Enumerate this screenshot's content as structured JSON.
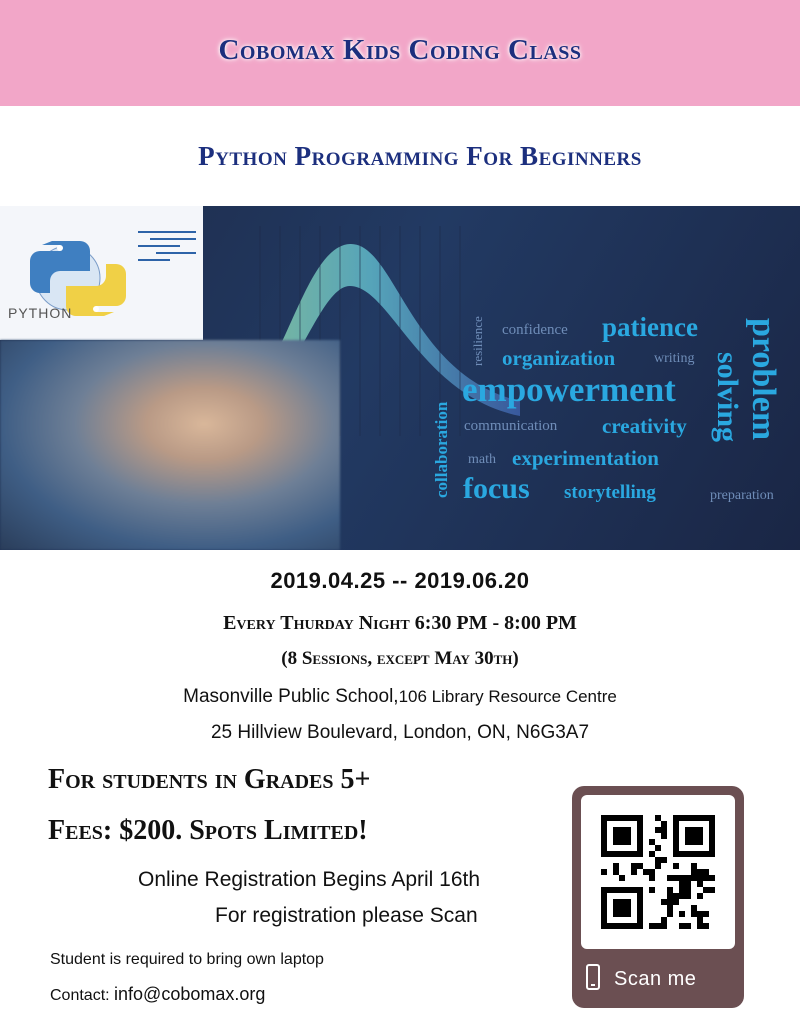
{
  "header": {
    "title": "Cobomax Kids Coding Class"
  },
  "subtitle": "Python Programming For Beginners",
  "banner": {
    "python_logo_text": "PYTHON",
    "words": [
      "confidence",
      "patience",
      "resilience",
      "organization",
      "writing",
      "problem",
      "solving",
      "empowerment",
      "collaboration",
      "communication",
      "creativity",
      "math",
      "experimentation",
      "focus",
      "storytelling",
      "preparation"
    ]
  },
  "schedule": {
    "dates": "2019.04.25 -- 2019.06.20",
    "when": "Every Thurday Night 6:30 PM - 8:00 PM",
    "sessions": "(8 Sessions, except May 30th)",
    "venue_school": "Masonville Public School,",
    "venue_room": "106 Library Resource Centre",
    "address": "25 Hillview Boulevard, London, ON, N6G3A7"
  },
  "details": {
    "grades": "For students in Grades 5+",
    "fees": "Fees: $200. Spots Limited!",
    "online_registration": "Online Registration Begins April 16th",
    "scan_instruction": "For registration please Scan",
    "laptop_note": "Student is required to bring own laptop",
    "contact_label": "Contact: ",
    "contact_email": "info@cobomax.org"
  },
  "qr": {
    "label": "Scan me"
  },
  "colors": {
    "header_bg": "#f2a6c8",
    "title_blue": "#1c2f7e",
    "banner_bg": "#1d2a48",
    "word_cyan": "#2aa8e0",
    "qr_card": "#6b4f52"
  }
}
